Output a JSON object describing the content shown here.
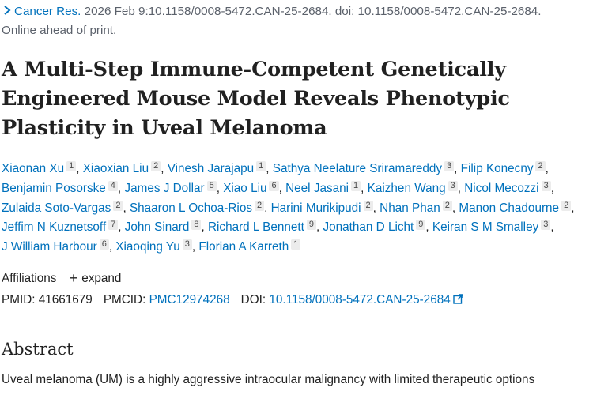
{
  "citation": {
    "journal": "Cancer Res.",
    "details": " 2026 Feb 9:10.1158/0008-5472.CAN-25-2684. doi: 10.1158/0008-5472.CAN-25-2684.",
    "status": "Online ahead of print."
  },
  "article": {
    "title": "A Multi-Step Immune-Competent Genetically Engineered Mouse Model Reveals Phenotypic Plasticity in Uveal Melanoma"
  },
  "authors": [
    {
      "name": "Xiaonan Xu",
      "aff": "1"
    },
    {
      "name": "Xiaoxian Liu",
      "aff": "2"
    },
    {
      "name": "Vinesh Jarajapu",
      "aff": "1"
    },
    {
      "name": "Sathya Neelature Sriramareddy",
      "aff": "3"
    },
    {
      "name": "Filip Konecny",
      "aff": "2"
    },
    {
      "name": "Benjamin Posorske",
      "aff": "4"
    },
    {
      "name": "James J Dollar",
      "aff": "5"
    },
    {
      "name": "Xiao Liu",
      "aff": "6"
    },
    {
      "name": "Neel Jasani",
      "aff": "1"
    },
    {
      "name": "Kaizhen Wang",
      "aff": "3"
    },
    {
      "name": "Nicol Mecozzi",
      "aff": "3"
    },
    {
      "name": "Zulaida Soto-Vargas",
      "aff": "2"
    },
    {
      "name": "Shaaron L Ochoa-Rios",
      "aff": "2"
    },
    {
      "name": "Harini Murikipudi",
      "aff": "2"
    },
    {
      "name": "Nhan Phan",
      "aff": "2"
    },
    {
      "name": "Manon Chadourne",
      "aff": "2"
    },
    {
      "name": "Jeffim N Kuznetsoff",
      "aff": "7"
    },
    {
      "name": "John Sinard",
      "aff": "8"
    },
    {
      "name": "Richard L Bennett",
      "aff": "9"
    },
    {
      "name": "Jonathan D Licht",
      "aff": "9"
    },
    {
      "name": "Keiran S M Smalley",
      "aff": "3"
    },
    {
      "name": "J William Harbour",
      "aff": "6"
    },
    {
      "name": "Xiaoqing Yu",
      "aff": "3"
    },
    {
      "name": "Florian A Karreth",
      "aff": "1"
    }
  ],
  "affiliations": {
    "label": "Affiliations",
    "expand_label": "expand"
  },
  "identifiers": {
    "pmid_label": "PMID:",
    "pmid": "41661679",
    "pmcid_label": "PMCID:",
    "pmcid": "PMC12974268",
    "doi_label": "DOI:",
    "doi": "10.1158/0008-5472.CAN-25-2684"
  },
  "abstract": {
    "heading": "Abstract",
    "text": "Uveal melanoma (UM) is a highly aggressive intraocular malignancy with limited therapeutic options"
  },
  "colors": {
    "link": "#0071bc",
    "text": "#212121",
    "muted": "#5b616b",
    "badge_bg": "#ececec"
  }
}
